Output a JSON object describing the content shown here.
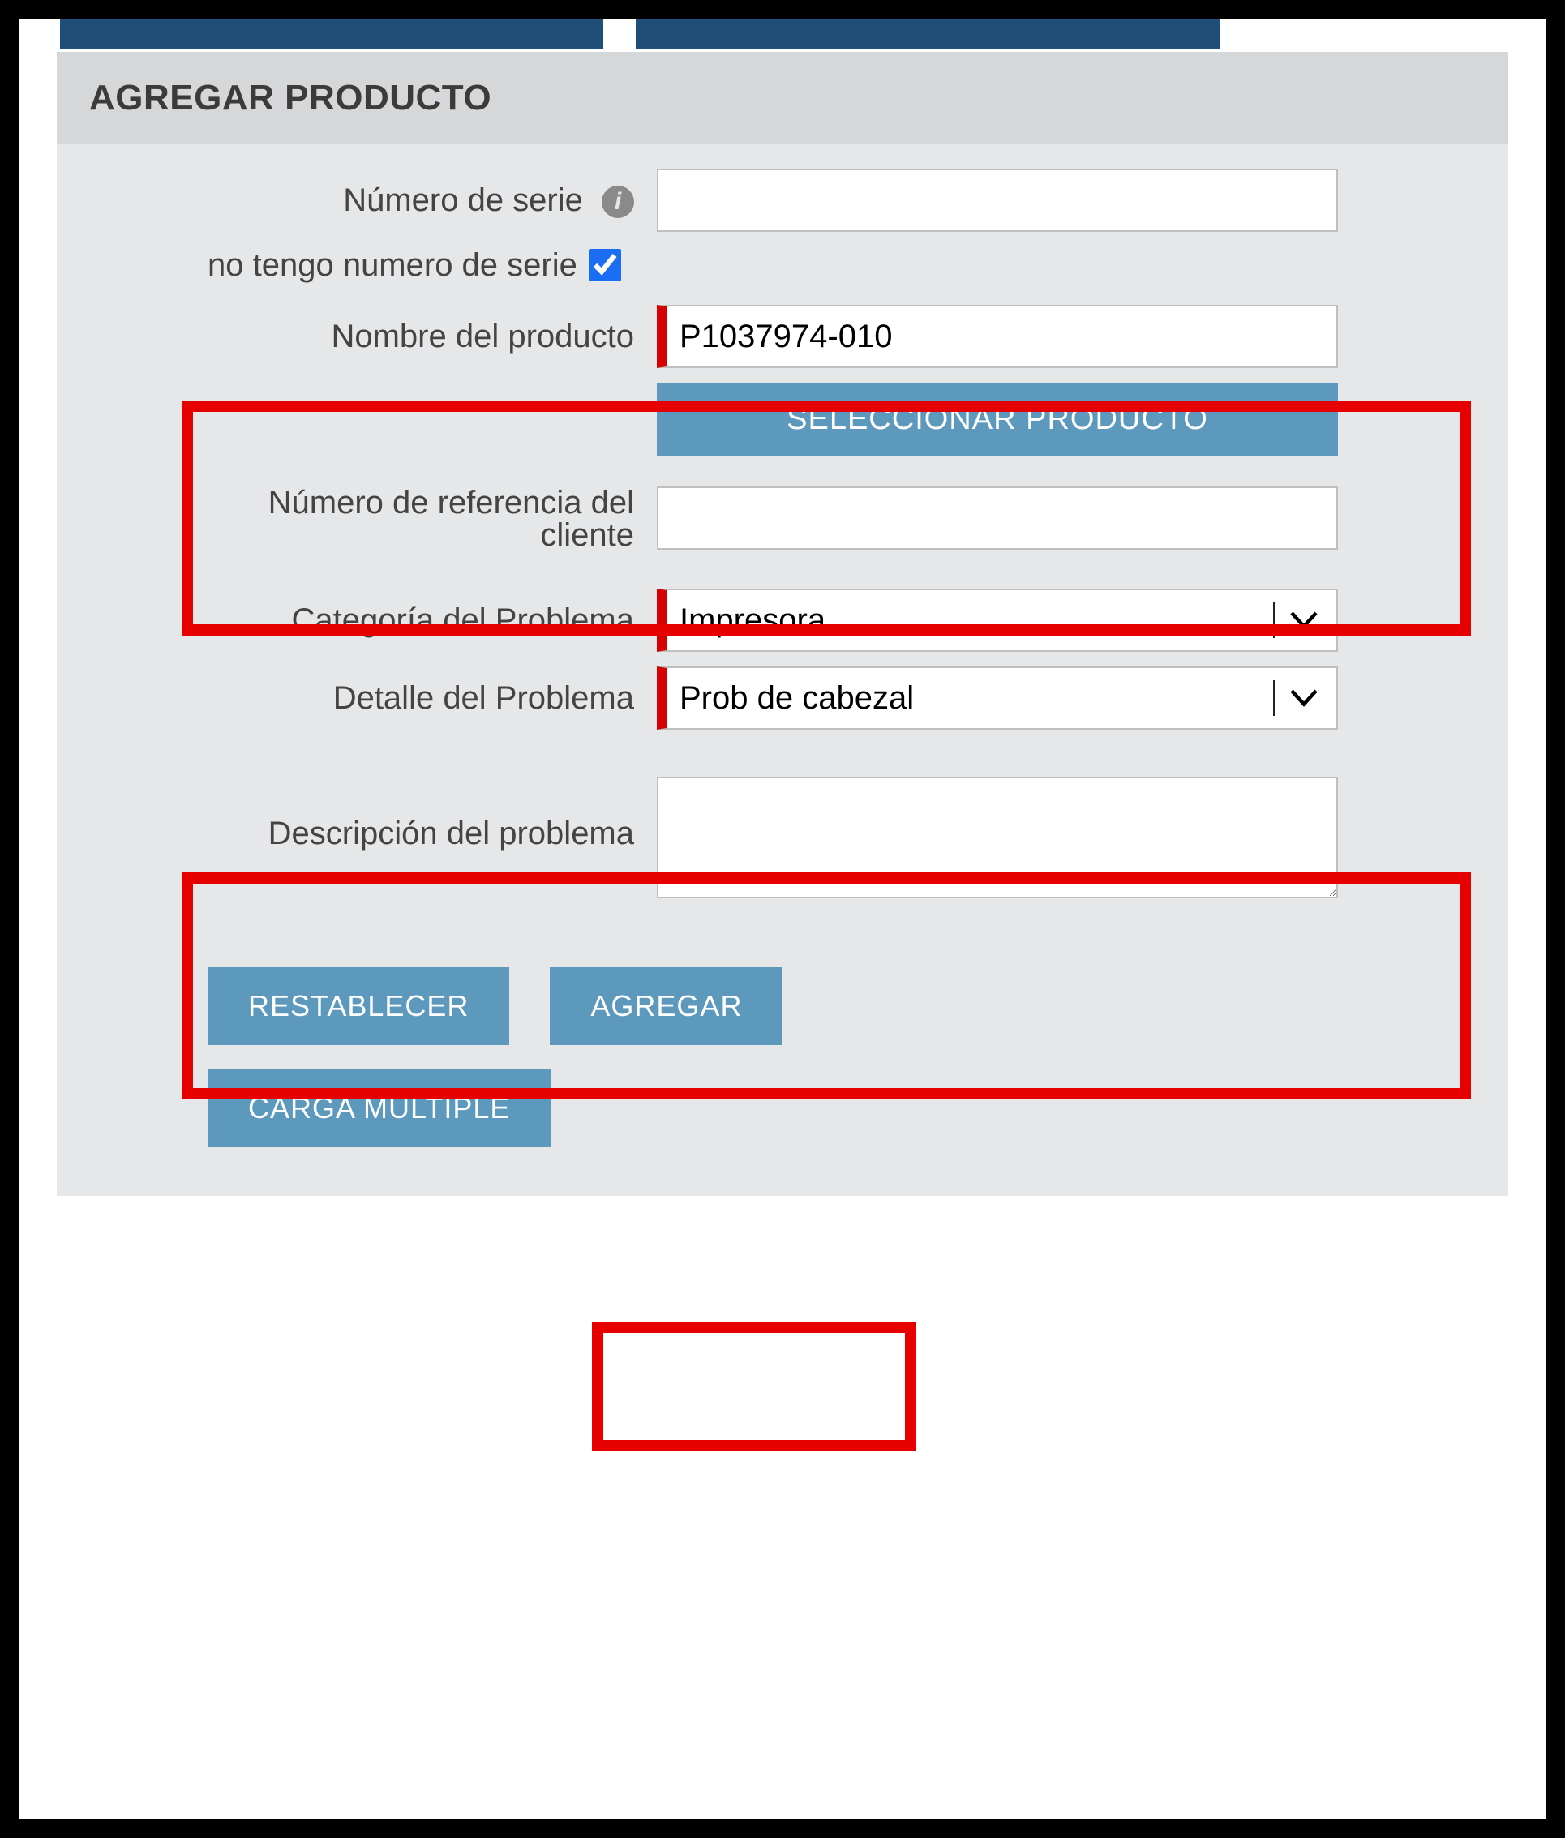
{
  "panel": {
    "title": "AGREGAR PRODUCTO"
  },
  "fields": {
    "serial_label": "Número de serie",
    "serial_value": "",
    "no_serial_label": "no tengo numero de serie",
    "product_name_label": "Nombre del producto",
    "product_name_value": "P1037974-010",
    "select_product_btn": "SELECCIONAR PRODUCTO",
    "customer_ref_label_line1": "Número de referencia del",
    "customer_ref_label_line2": "cliente",
    "customer_ref_value": "",
    "problem_category_label": "Categoría del Problema",
    "problem_category_value": "Impresora",
    "problem_detail_label": "Detalle del Problema",
    "problem_detail_value": "Prob de cabezal",
    "problem_description_label": "Descripción del problema",
    "problem_description_value": ""
  },
  "buttons": {
    "reset": "RESTABLECER",
    "add": "AGREGAR",
    "bulk": "CARGA MÚLTIPLE"
  },
  "icons": {
    "info": "i"
  },
  "highlighted": [
    "product-name-section",
    "problem-section",
    "add-button"
  ]
}
